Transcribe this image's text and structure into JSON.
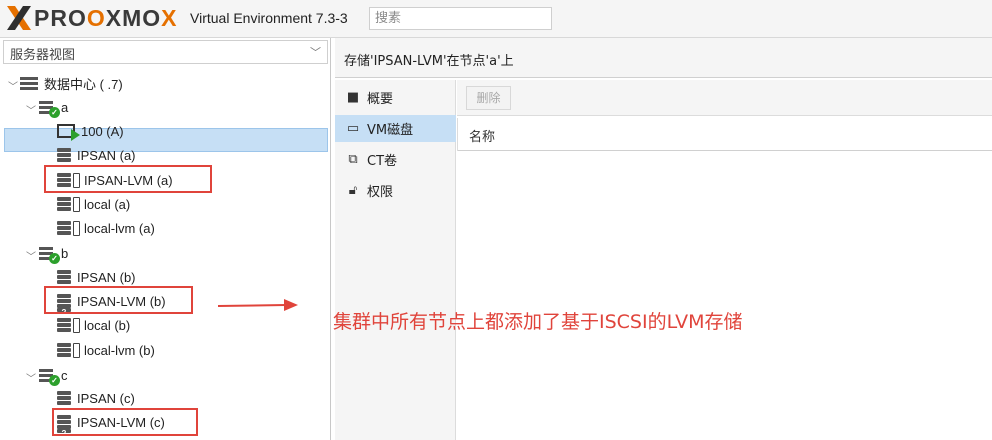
{
  "header": {
    "logo_prefix": "PRO",
    "logo_x": "X",
    "logo_mo": "MO",
    "logo_suffix": "X",
    "version": "Virtual Environment 7.3-3",
    "search_placeholder": "搜素"
  },
  "left_panel": {
    "view_select": "服务器视图",
    "tree": {
      "datacenter": "数据中心 (                  .7)",
      "nodes": [
        {
          "name": "a",
          "children": [
            "100 (A)",
            "IPSAN (a)",
            "IPSAN-LVM (a)",
            "local (a)",
            "local-lvm (a)"
          ]
        },
        {
          "name": "b",
          "children": [
            "IPSAN (b)",
            "IPSAN-LVM (b)",
            "local (b)",
            "local-lvm (b)"
          ]
        },
        {
          "name": "c",
          "children": [
            "IPSAN (c)",
            "IPSAN-LVM (c)"
          ]
        }
      ]
    }
  },
  "main": {
    "title": "存储'IPSAN-LVM'在节点'a'上",
    "nav": [
      {
        "label": "概要",
        "icon": "book-icon"
      },
      {
        "label": "VM磁盘",
        "icon": "hdd-icon",
        "active": true
      },
      {
        "label": "CT卷",
        "icon": "ct-volume-icon"
      },
      {
        "label": "权限",
        "icon": "unlock-icon"
      }
    ],
    "toolbar": {
      "delete_label": "删除"
    },
    "grid": {
      "columns": [
        "名称"
      ]
    }
  },
  "annotation": {
    "text": "集群中所有节点上都添加了基于ISCSI的LVM存储",
    "color": "#e0443b"
  },
  "colors": {
    "accent_orange": "#e57000",
    "selection": "#c6dff5",
    "status_green": "#2ca02c"
  }
}
